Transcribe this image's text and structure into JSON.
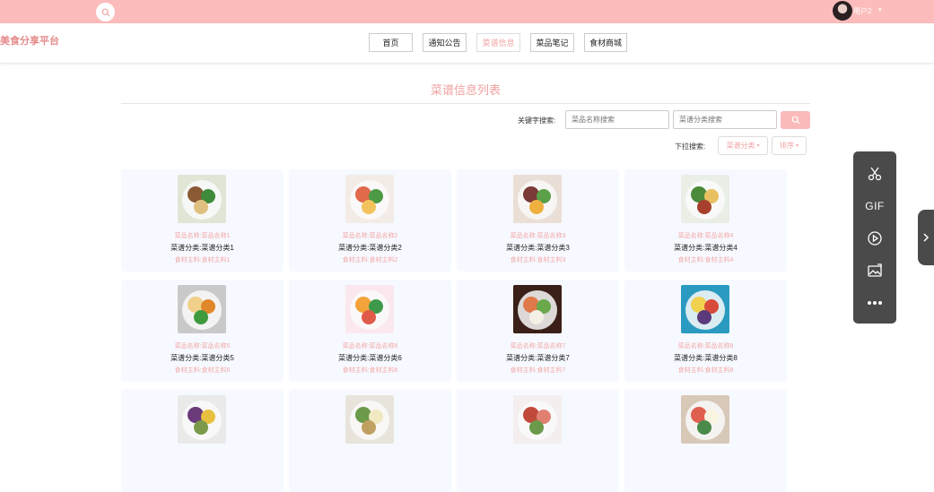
{
  "topbar": {
    "username": "用户2",
    "caret": "▾"
  },
  "brand": "美食分享平台",
  "nav": [
    {
      "label": "首页",
      "active": false
    },
    {
      "label": "通知公告",
      "active": false
    },
    {
      "label": "菜谱信息",
      "active": true
    },
    {
      "label": "菜品笔记",
      "active": false
    },
    {
      "label": "食材商城",
      "active": false
    }
  ],
  "page_title": "菜谱信息列表",
  "search": {
    "keyword_label": "关键字搜索:",
    "name_placeholder": "菜品名称搜索",
    "category_placeholder": "菜谱分类搜索",
    "dropdown_label": "下拉搜索:",
    "category_dropdown": "菜谱分类",
    "sort_dropdown": "排序"
  },
  "recipes": [
    {
      "name": "菜品名称:菜品名称1",
      "category": "菜谱分类:菜谱分类1",
      "ingredients": "食材主料:食材主料1"
    },
    {
      "name": "菜品名称:菜品名称2",
      "category": "菜谱分类:菜谱分类2",
      "ingredients": "食材主料:食材主料2"
    },
    {
      "name": "菜品名称:菜品名称3",
      "category": "菜谱分类:菜谱分类3",
      "ingredients": "食材主料:食材主料3"
    },
    {
      "name": "菜品名称:菜品名称4",
      "category": "菜谱分类:菜谱分类4",
      "ingredients": "食材主料:食材主料4"
    },
    {
      "name": "菜品名称:菜品名称5",
      "category": "菜谱分类:菜谱分类5",
      "ingredients": "食材主料:食材主料5"
    },
    {
      "name": "菜品名称:菜品名称6",
      "category": "菜谱分类:菜谱分类6",
      "ingredients": "食材主料:食材主料6"
    },
    {
      "name": "菜品名称:菜品名称7",
      "category": "菜谱分类:菜谱分类7",
      "ingredients": "食材主料:食材主料7"
    },
    {
      "name": "菜品名称:菜品名称8",
      "category": "菜谱分类:菜谱分类8",
      "ingredients": "食材主料:食材主料8"
    },
    {
      "name": "",
      "category": "",
      "ingredients": ""
    },
    {
      "name": "",
      "category": "",
      "ingredients": ""
    },
    {
      "name": "",
      "category": "",
      "ingredients": ""
    },
    {
      "name": "",
      "category": "",
      "ingredients": ""
    }
  ],
  "side_tools": [
    "scissors-icon",
    "GIF",
    "record-icon",
    "image-icon",
    "more-icon"
  ],
  "colors": {
    "accent": "#fdbcbc",
    "text_pink": "#f4a8a8",
    "card_bg": "#f6f9ff",
    "toolbar": "#4a4a4a"
  }
}
